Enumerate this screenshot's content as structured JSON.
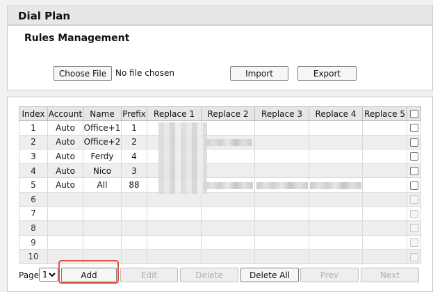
{
  "header": {
    "title": "Dial Plan"
  },
  "rules": {
    "title": "Rules Management",
    "choose_file_label": "Choose File",
    "file_status": "No file chosen",
    "import_label": "Import",
    "export_label": "Export"
  },
  "table": {
    "columns": [
      "Index",
      "Account",
      "Name",
      "Prefix",
      "Replace 1",
      "Replace 2",
      "Replace 3",
      "Replace 4",
      "Replace 5"
    ],
    "rows": [
      {
        "index": "1",
        "account": "Auto",
        "name": "Office+1",
        "prefix": "1"
      },
      {
        "index": "2",
        "account": "Auto",
        "name": "Office+2",
        "prefix": "2"
      },
      {
        "index": "3",
        "account": "Auto",
        "name": "Ferdy",
        "prefix": "4"
      },
      {
        "index": "4",
        "account": "Auto",
        "name": "Nico",
        "prefix": "3"
      },
      {
        "index": "5",
        "account": "Auto",
        "name": "All",
        "prefix": "88"
      },
      {
        "index": "6",
        "account": "",
        "name": "",
        "prefix": ""
      },
      {
        "index": "7",
        "account": "",
        "name": "",
        "prefix": ""
      },
      {
        "index": "8",
        "account": "",
        "name": "",
        "prefix": ""
      },
      {
        "index": "9",
        "account": "",
        "name": "",
        "prefix": ""
      },
      {
        "index": "10",
        "account": "",
        "name": "",
        "prefix": ""
      }
    ]
  },
  "pager": {
    "page_label": "Page",
    "page_value": "1",
    "add_label": "Add",
    "edit_label": "Edit",
    "delete_label": "Delete",
    "delete_all_label": "Delete All",
    "prev_label": "Prev",
    "next_label": "Next"
  },
  "colors": {
    "highlight": "#e0533a",
    "header_bg": "#e7e7e7"
  }
}
